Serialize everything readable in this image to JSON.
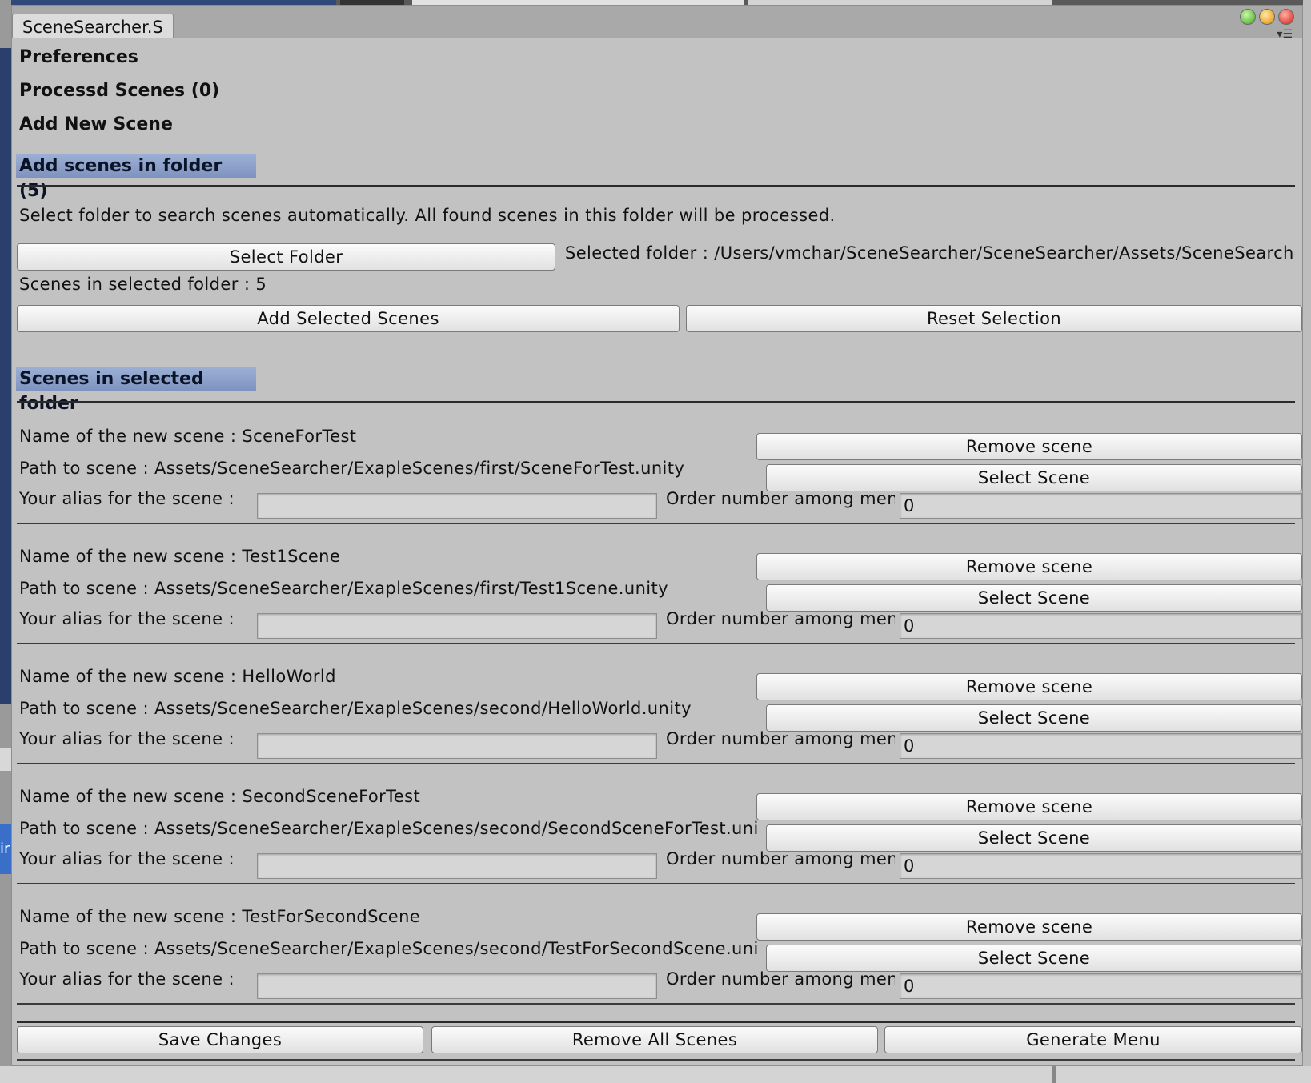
{
  "window": {
    "tab_title": "SceneSearcher.S"
  },
  "menu": {
    "preferences": "Preferences",
    "processed_scenes": "Processd Scenes (0)",
    "add_new_scene": "Add New Scene",
    "add_scenes_in_folder": "Add scenes in folder (5)"
  },
  "folder_panel": {
    "description": "Select folder to search scenes automatically. All found scenes in this folder will be processed.",
    "select_folder_label": "Select Folder",
    "selected_folder_text": "Selected folder : /Users/vmchar/SceneSearcher/SceneSearcher/Assets/SceneSearche",
    "scenes_count_text": "Scenes in selected folder : 5",
    "add_selected_label": "Add Selected Scenes",
    "reset_selection_label": "Reset Selection"
  },
  "scenes_header": "Scenes in selected folder",
  "scene_labels": {
    "remove_button": "Remove scene",
    "select_button": "Select Scene",
    "alias_label": "Your alias for the scene :",
    "order_label": "Order number among menu"
  },
  "scenes": [
    {
      "name_text": "Name of the new scene : SceneForTest",
      "path_text": "Path to scene : Assets/SceneSearcher/ExapleScenes/first/SceneForTest.unity",
      "alias": "",
      "order": "0"
    },
    {
      "name_text": "Name of the new scene : Test1Scene",
      "path_text": "Path to scene : Assets/SceneSearcher/ExapleScenes/first/Test1Scene.unity",
      "alias": "",
      "order": "0"
    },
    {
      "name_text": "Name of the new scene : HelloWorld",
      "path_text": "Path to scene : Assets/SceneSearcher/ExapleScenes/second/HelloWorld.unity",
      "alias": "",
      "order": "0"
    },
    {
      "name_text": "Name of the new scene : SecondSceneForTest",
      "path_text": "Path to scene : Assets/SceneSearcher/ExapleScenes/second/SecondSceneForTest.uni",
      "alias": "",
      "order": "0"
    },
    {
      "name_text": "Name of the new scene : TestForSecondScene",
      "path_text": "Path to scene : Assets/SceneSearcher/ExapleScenes/second/TestForSecondScene.uni",
      "alias": "",
      "order": "0"
    }
  ],
  "footer": {
    "save_changes": "Save Changes",
    "remove_all": "Remove All Scenes",
    "generate_menu": "Generate Menu"
  },
  "background": {
    "left_tag_text": "ir"
  },
  "colors": {
    "panel_bg": "#c2c2c2",
    "header_highlight": "#8a9dc9"
  },
  "icons": {
    "window_controls": [
      "traffic-light-green",
      "traffic-light-yellow",
      "traffic-light-red"
    ],
    "tab_menu": "context-menu-icon"
  }
}
